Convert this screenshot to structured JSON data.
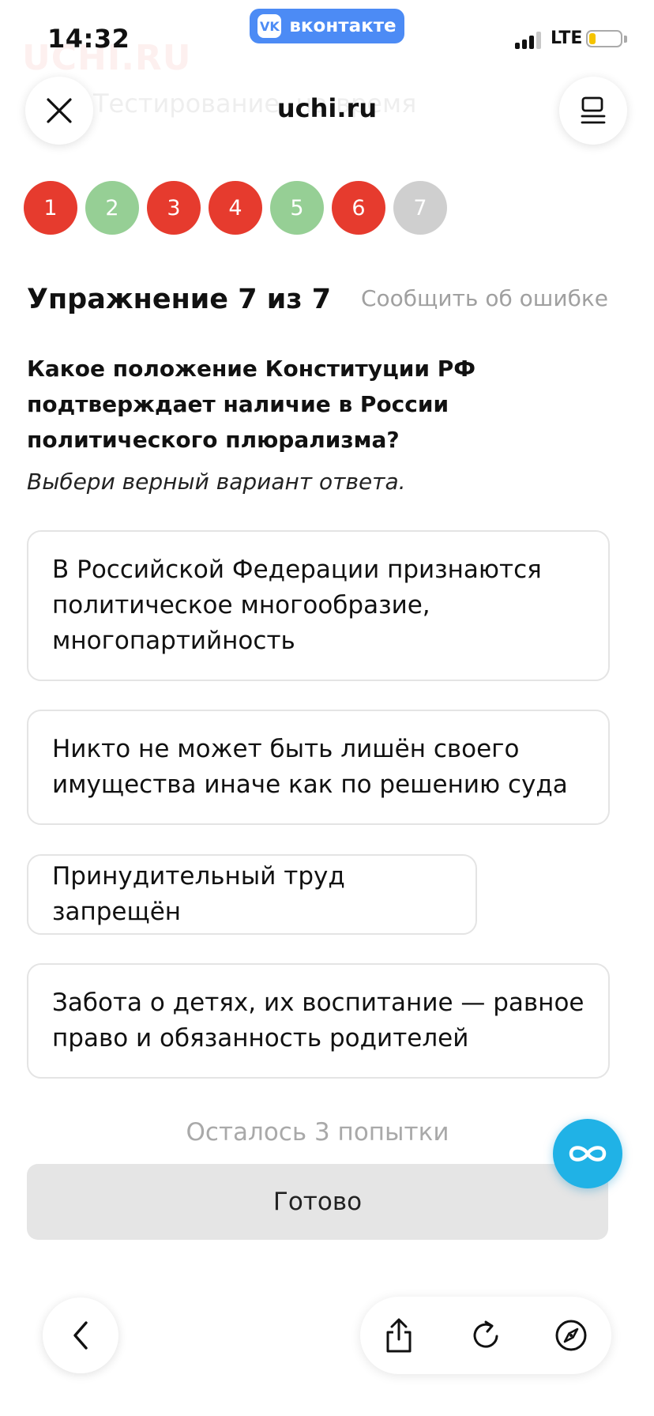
{
  "status_bar": {
    "time": "14:32",
    "vk_badge": "вконтакте",
    "vk_logo": "VK",
    "network": "LTE"
  },
  "background_text": {
    "logo": "UCHI.RU",
    "header": "Тестирование, на время"
  },
  "nav": {
    "title": "uchi.ru",
    "close_icon": "close-icon",
    "menu_icon": "menu-icon"
  },
  "progress": {
    "items": [
      {
        "label": "1",
        "status": "wrong"
      },
      {
        "label": "2",
        "status": "right"
      },
      {
        "label": "3",
        "status": "wrong"
      },
      {
        "label": "4",
        "status": "wrong"
      },
      {
        "label": "5",
        "status": "right"
      },
      {
        "label": "6",
        "status": "wrong"
      },
      {
        "label": "7",
        "status": "pending"
      }
    ],
    "colors": {
      "wrong": "#e63b2e",
      "right": "#96cf95",
      "pending": "#cfcfcf"
    }
  },
  "exercise": {
    "title": "Упражнение 7 из 7",
    "report_link": "Сообщить об ошибке",
    "question": "Какое положение Конституции РФ подтверждает наличие в России политического плюрализма?",
    "instruction": "Выбери верный вариант ответа.",
    "options": [
      "В Российской Федерации признаются политическое многообразие, многопартийность",
      "Никто не может быть лишён своего имущества иначе как по решению суда",
      "Принудительный труд запрещён",
      "Забота о детях, их воспитание — равное право и обязанность родителей"
    ],
    "attempts": "Осталось 3 попытки",
    "done_button": "Готово"
  },
  "browser_bar": {
    "icons": [
      "back-icon",
      "share-icon",
      "reload-icon",
      "compass-icon"
    ]
  },
  "colors": {
    "accent_infinity": "#20b2e6",
    "vk_blue": "#4c8bf5"
  }
}
